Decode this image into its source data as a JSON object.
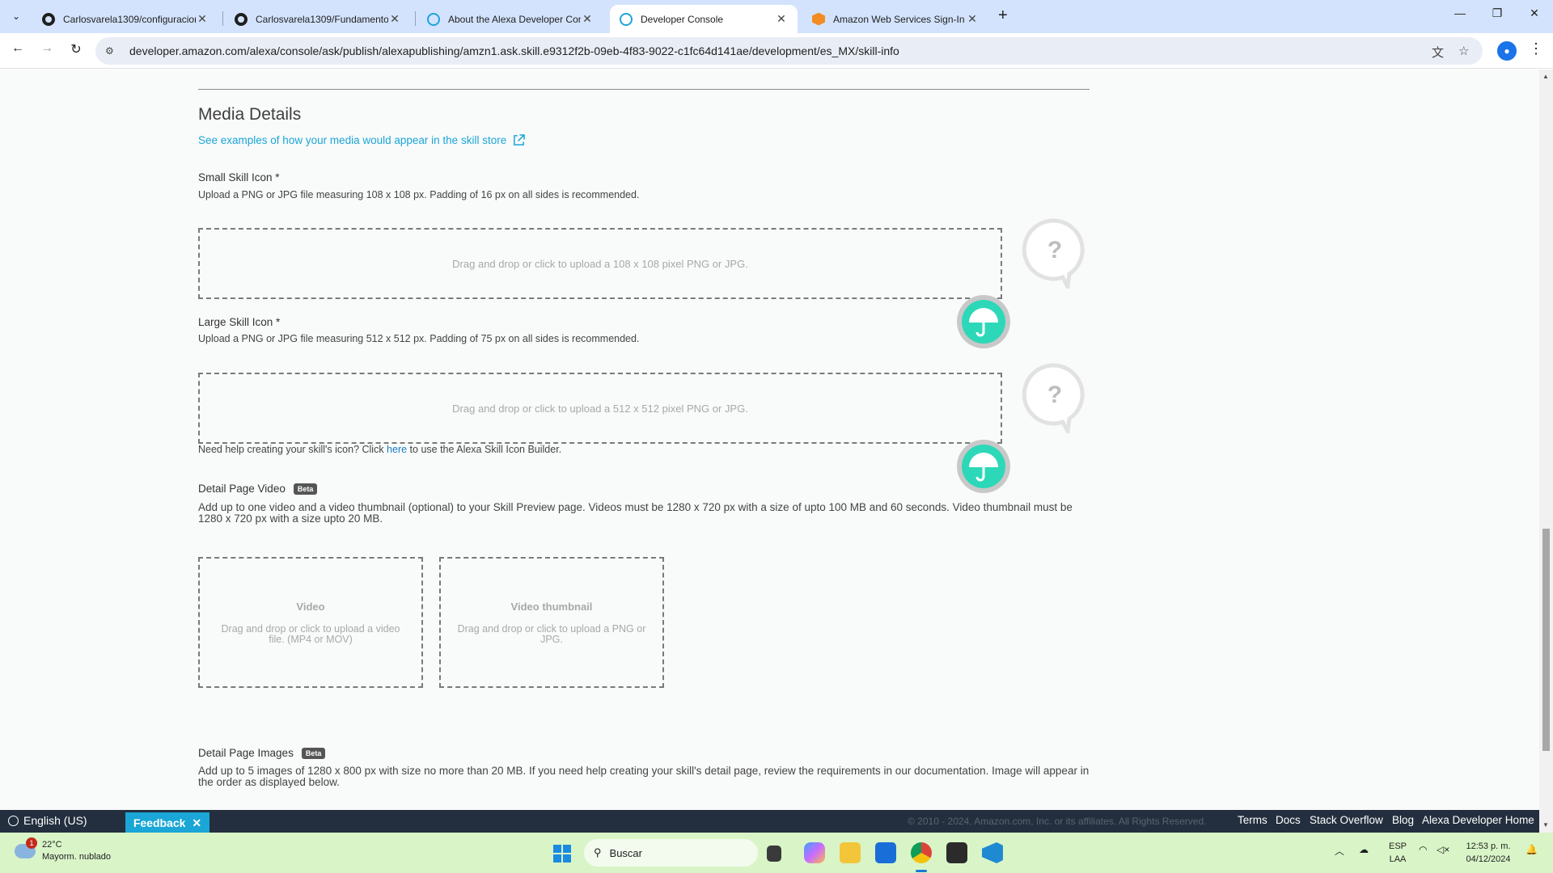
{
  "browser": {
    "tabs": [
      {
        "title": "Carlosvarela1309/configuracion",
        "icon": "github-icon"
      },
      {
        "title": "Carlosvarela1309/Fundamentos",
        "icon": "github-icon"
      },
      {
        "title": "About the Alexa Developer Con",
        "icon": "alexa-icon"
      },
      {
        "title": "Developer Console",
        "icon": "alexa-icon",
        "active": true
      },
      {
        "title": "Amazon Web Services Sign-In",
        "icon": "aws-icon"
      }
    ],
    "new_tab": "+",
    "close_glyph": "✕",
    "url": "developer.amazon.com/alexa/console/ask/publish/alexapublishing/amzn1.ask.skill.e9312f2b-09eb-4f83-9022-c1fc64d141ae/development/es_MX/skill-info"
  },
  "media": {
    "title": "Media Details",
    "examples_link": "See examples of how your media would appear in the skill store",
    "small_icon": {
      "label": "Small Skill Icon *",
      "help": "Upload a PNG or JPG file measuring 108 x 108 px. Padding of 16 px on all sides is recommended.",
      "drop_text": "Drag and drop or click to upload a 108 x 108 pixel PNG or JPG."
    },
    "large_icon": {
      "label": "Large Skill Icon *",
      "help": "Upload a PNG or JPG file measuring 512 x 512 px. Padding of 75 px on all sides is recommended.",
      "drop_text": "Drag and drop or click to upload a 512 x 512 pixel PNG or JPG."
    },
    "icon_builder": {
      "prefix": "Need help creating your skill's icon? Click ",
      "link": "here",
      "suffix": " to use the Alexa Skill Icon Builder."
    },
    "video": {
      "label": "Detail Page Video",
      "badge": "Beta",
      "help": "Add up to one video and a video thumbnail (optional) to your Skill Preview page. Videos must be 1280 x 720 px with a size of upto 100 MB and 60 seconds. Video thumbnail must be 1280 x 720 px with a size upto 20 MB.",
      "video_box_title": "Video",
      "video_box_text": "Drag and drop or click to upload a video file. (MP4 or MOV)",
      "thumb_box_title": "Video thumbnail",
      "thumb_box_text": "Drag and drop or click to upload a PNG or JPG."
    },
    "images": {
      "label": "Detail Page Images",
      "badge": "Beta",
      "help": "Add up to 5 images of 1280 x 800 px with size no more than 20 MB. If you need help creating your skill's detail page, review the requirements in our documentation. Image will appear in the order as displayed below."
    }
  },
  "footer": {
    "language": "English (US)",
    "feedback": "Feedback",
    "copyright": "© 2010 - 2024, Amazon.com, Inc. or its affiliates. All Rights Reserved.",
    "links": [
      "Terms",
      "Docs",
      "Stack Overflow",
      "Blog",
      "Alexa Developer Home"
    ]
  },
  "taskbar": {
    "temperature": "22°C",
    "weather": "Mayorm. nublado",
    "weather_badge": "1",
    "search_placeholder": "Buscar",
    "lang_top": "ESP",
    "lang_bottom": "LAA",
    "time": "12:53 p. m.",
    "date": "04/12/2024"
  },
  "colors": {
    "accent": "#1aa6d6",
    "footer_bg": "#232f3e",
    "taskbar_bg": "#d9f5c8"
  }
}
